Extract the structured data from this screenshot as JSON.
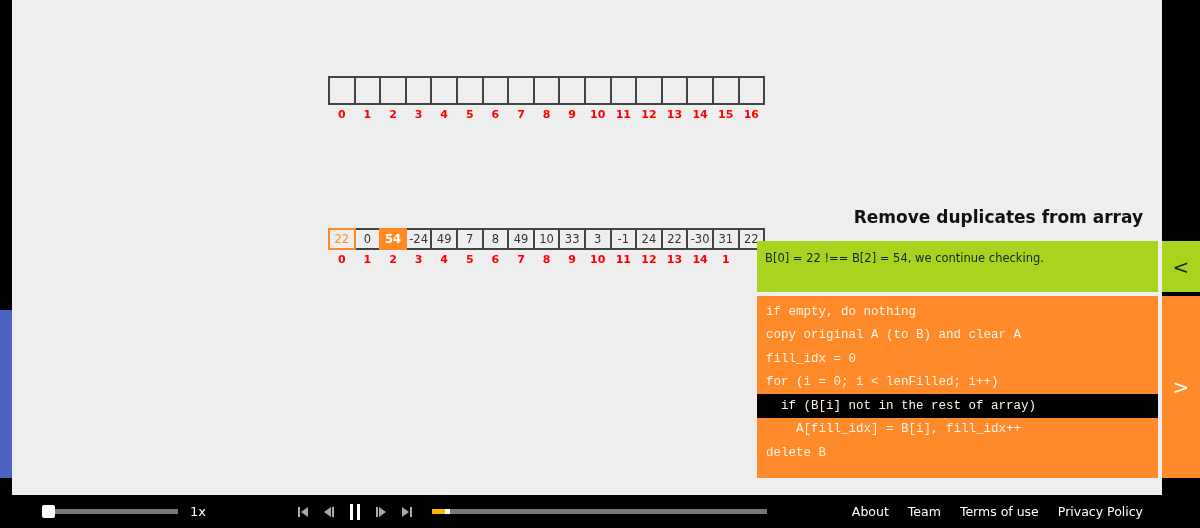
{
  "title": "Remove duplicates from array",
  "array_top": {
    "indices": [
      "0",
      "1",
      "2",
      "3",
      "4",
      "5",
      "6",
      "7",
      "8",
      "9",
      "10",
      "11",
      "12",
      "13",
      "14",
      "15",
      "16"
    ]
  },
  "array_bottom": {
    "cells": [
      {
        "value": "22",
        "outlined": true,
        "filled": false
      },
      {
        "value": "0",
        "outlined": false,
        "filled": false
      },
      {
        "value": "54",
        "outlined": false,
        "filled": true
      },
      {
        "value": "-24",
        "outlined": false,
        "filled": false
      },
      {
        "value": "49",
        "outlined": false,
        "filled": false
      },
      {
        "value": "7",
        "outlined": false,
        "filled": false
      },
      {
        "value": "8",
        "outlined": false,
        "filled": false
      },
      {
        "value": "49",
        "outlined": false,
        "filled": false
      },
      {
        "value": "10",
        "outlined": false,
        "filled": false
      },
      {
        "value": "33",
        "outlined": false,
        "filled": false
      },
      {
        "value": "3",
        "outlined": false,
        "filled": false
      },
      {
        "value": "-1",
        "outlined": false,
        "filled": false
      },
      {
        "value": "24",
        "outlined": false,
        "filled": false
      },
      {
        "value": "22",
        "outlined": false,
        "filled": false
      },
      {
        "value": "-30",
        "outlined": false,
        "filled": false
      },
      {
        "value": "31",
        "outlined": false,
        "filled": false
      },
      {
        "value": "22",
        "outlined": false,
        "filled": false
      }
    ],
    "indices": [
      "0",
      "1",
      "2",
      "3",
      "4",
      "5",
      "6",
      "7",
      "8",
      "9",
      "10",
      "11",
      "12",
      "13",
      "14",
      "1"
    ]
  },
  "status": "B[0] = 22 !== B[2] = 54, we continue checking.",
  "code": [
    {
      "text": "if empty, do nothing",
      "selected": false
    },
    {
      "text": "copy original A (to B) and clear A",
      "selected": false
    },
    {
      "text": "fill_idx = 0",
      "selected": false
    },
    {
      "text": "for (i = 0; i < lenFilled; i++)",
      "selected": false,
      "children": [
        {
          "text": "if (B[i] not in the rest of array)",
          "selected": true,
          "children": [
            {
              "text": "A[fill_idx] = B[i], fill_idx++",
              "selected": false
            }
          ]
        }
      ]
    },
    {
      "text": "delete B",
      "selected": false
    }
  ],
  "nav": {
    "prev": "<",
    "next": ">"
  },
  "player": {
    "speed_slider": {
      "level": 0
    },
    "speed": "1x",
    "playing": true,
    "progress": {
      "level": 0.04
    }
  },
  "footer_links": [
    "About",
    "Team",
    "Terms of use",
    "Privacy Policy"
  ]
}
